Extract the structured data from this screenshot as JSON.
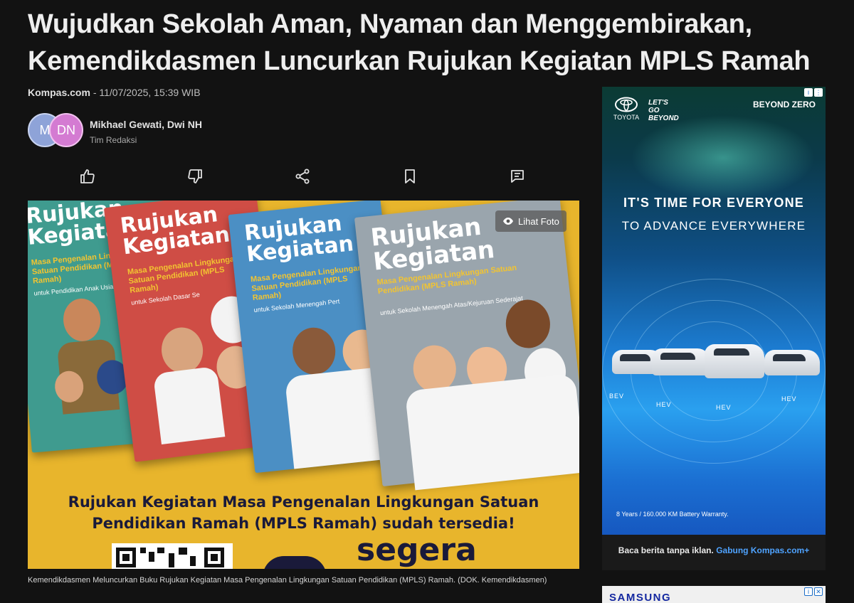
{
  "article": {
    "title": "Wujudkan Sekolah Aman, Nyaman dan Menggembirakan, Kemendikdasmen Luncurkan Rujukan Kegiatan MPLS Ramah",
    "source": "Kompas.com",
    "datetime": "- 11/07/2025, 15:39 WIB",
    "avatar_1": "M",
    "avatar_2": "DN",
    "authors": "Mikhael Gewati,  Dwi NH",
    "team": "Tim Redaksi",
    "caption": "Kemendikdasmen Meluncurkan Buku Rujukan Kegiatan Masa Pengenalan Lingkungan Satuan Pendidikan (MPLS) Ramah.  (DOK. Kemendikdasmen)"
  },
  "actions": [
    "like-icon",
    "dislike-icon",
    "share-icon",
    "bookmark-icon",
    "comment-icon"
  ],
  "hero": {
    "photo_button": "Lihat Foto",
    "books": [
      {
        "title": "Rujukan Kegiatan",
        "subtitle": "Masa Pengenalan Lingkungan Satuan Pendidikan (MPLS Ramah)",
        "level": "untuk Pendidikan Anak Usia",
        "color": "#3f9b8f"
      },
      {
        "title": "Rujukan Kegiatan",
        "subtitle": "Masa Pengenalan Lingkungan Satuan Pendidikan (MPLS Ramah)",
        "level": "untuk Sekolah Dasar Se",
        "color": "#cf4d45"
      },
      {
        "title": "Rujukan Kegiatan",
        "subtitle": "Masa Pengenalan Lingkungan Satuan Pendidikan (MPLS Ramah)",
        "level": "untuk Sekolah Menengah Pert",
        "color": "#4b8fc4"
      },
      {
        "title": "Rujukan Kegiatan",
        "subtitle": "Masa Pengenalan Lingkungan Satuan Pendidikan (MPLS Ramah)",
        "level": "untuk Sekolah Menengah Atas/Kejuruan Sederajat",
        "color": "#9aa5ad"
      }
    ],
    "banner_line1": "Rujukan Kegiatan Masa Pengenalan Lingkungan Satuan",
    "banner_line2": "Pendidikan Ramah (MPLS Ramah) sudah tersedia!",
    "banner_cta": "segera"
  },
  "ad": {
    "brand": "TOYOTA",
    "tagline": "LET'S GO BEYOND",
    "campaign": "BEYOND ZERO",
    "headline": "IT'S TIME FOR EVERYONE",
    "subheadline": "TO ADVANCE EVERYWHERE",
    "labels": [
      "BEV",
      "HEV",
      "HEV",
      "HEV"
    ],
    "warranty": "8 Years / 160.000 KM Battery Warranty.",
    "footer_text": "Baca berita tanpa iklan.",
    "footer_link": "Gabung Kompas.com+"
  },
  "ad2": {
    "brand": "SAMSUNG"
  }
}
